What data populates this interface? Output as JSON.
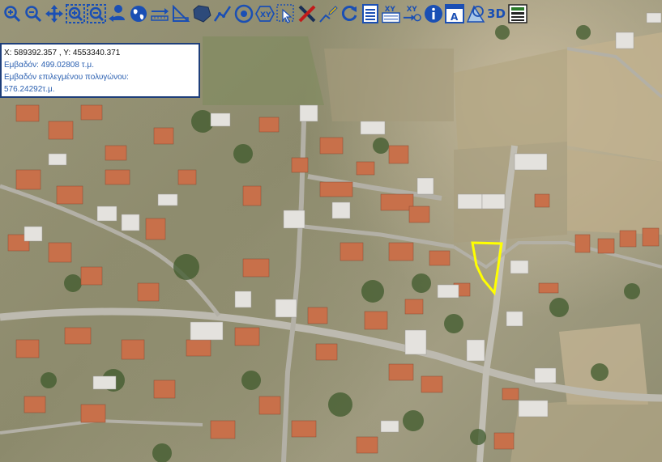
{
  "toolbar": {
    "tools": [
      "zoom-in-icon",
      "zoom-out-icon",
      "pan-icon",
      "zoom-box-in-icon",
      "zoom-box-out-icon",
      "locate-user-icon",
      "globe-icon",
      "measure-distance-icon",
      "measure-area-icon",
      "polygon-icon",
      "polyline-icon",
      "circle-target-icon",
      "xy-polygon-icon",
      "select-icon",
      "clear-icon",
      "edit-vertex-icon",
      "refresh-icon",
      "list-icon",
      "xy-table-icon",
      "xy-goto-icon",
      "info-icon",
      "text-label-icon",
      "layers-icon",
      "3d-view-icon",
      "legend-icon"
    ],
    "label_3d": "3D"
  },
  "info": {
    "coords": "X: 589392.357 , Y: 4553340.371",
    "area_label": "Εμβαδόν: 499.02808 τ.μ.",
    "selected_area_label": "Εμβαδόν επιλεγμένου πολυγώνου:",
    "selected_area_value": "576.24292τ.μ."
  },
  "colors": {
    "toolbar_icon": "#1a4fb4",
    "highlight_polygon": "#ffff00",
    "info_border": "#1f3f7a",
    "info_text_blue": "#2a5fb0"
  }
}
